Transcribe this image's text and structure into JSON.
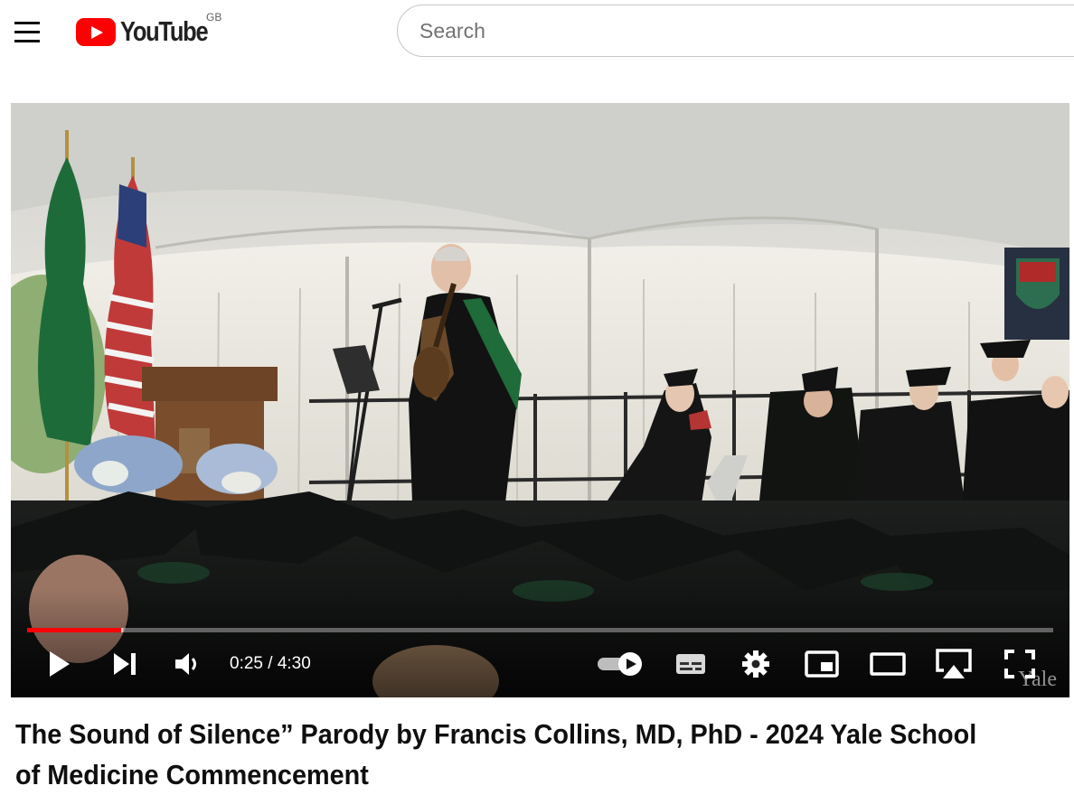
{
  "header": {
    "logo_text": "YouTube",
    "country_code": "GB",
    "search_placeholder": "Search"
  },
  "player": {
    "current_time": "0:25",
    "duration": "4:30",
    "time_display": "0:25 / 4:30",
    "progress_fraction": 0.092,
    "buffered_fraction": 0.093,
    "autoplay_on": true,
    "watermark": "Yale",
    "colors": {
      "progress": "#ff0000",
      "controls": "#ffffff"
    }
  },
  "video": {
    "title": "The Sound of Silence” Parody by Francis Collins, MD, PhD - 2024 Yale School of Medicine Commencement"
  },
  "icons": [
    "menu-icon",
    "youtube-logo-icon",
    "play-icon",
    "next-icon",
    "volume-icon",
    "autoplay-toggle-icon",
    "subtitles-icon",
    "settings-gear-icon",
    "miniplayer-icon",
    "theater-mode-icon",
    "airplay-icon",
    "fullscreen-icon"
  ]
}
